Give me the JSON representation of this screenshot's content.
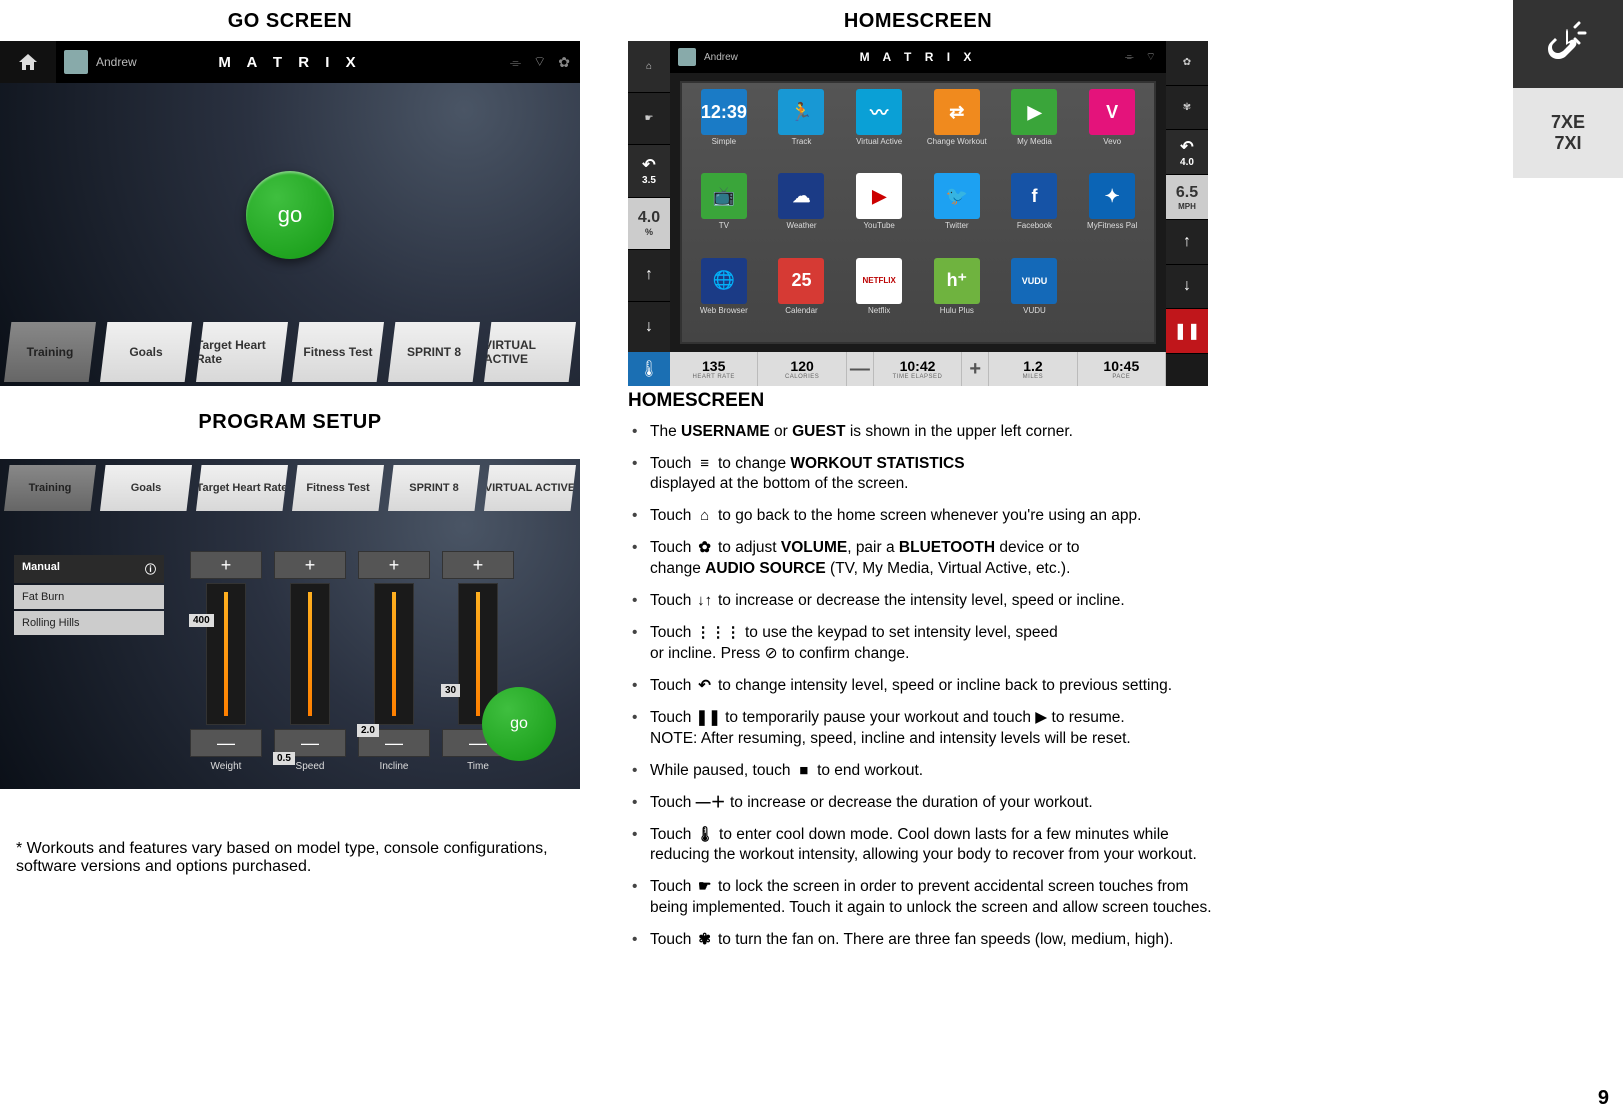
{
  "titles": {
    "go": "GO SCREEN",
    "program": "PROGRAM SETUP",
    "home": "HOMESCREEN"
  },
  "go_screen": {
    "user": "Andrew",
    "logo": "M A T R I X",
    "go_label": "go",
    "tabs": [
      "Training",
      "Goals",
      "Target Heart Rate",
      "Fitness Test",
      "SPRINT 8",
      "VIRTUAL ACTIVE"
    ]
  },
  "program_setup": {
    "tabs": [
      "Training",
      "Goals",
      "Target Heart Rate",
      "Fitness Test",
      "SPRINT 8",
      "VIRTUAL ACTIVE"
    ],
    "menu": [
      "Manual",
      "Fat Burn",
      "Rolling Hills"
    ],
    "sliders": [
      {
        "label": "Weight",
        "value": "400"
      },
      {
        "label": "Speed",
        "value": "0.5"
      },
      {
        "label": "Incline",
        "value": "2.0"
      },
      {
        "label": "Time",
        "value": "30"
      }
    ],
    "go_label": "go"
  },
  "home_screen": {
    "user": "Andrew",
    "logo": "M A T R I X",
    "left_rail": {
      "back_val": "3.5",
      "pct_val": "4.0",
      "pct_unit": "%"
    },
    "right_rail": {
      "back_val": "4.0",
      "spd_val": "6.5",
      "spd_unit": "MPH"
    },
    "apps": [
      {
        "label": "Simple",
        "color": "#1a7bc6",
        "glyph": "12:39"
      },
      {
        "label": "Track",
        "color": "#1898d4",
        "glyph": "🏃"
      },
      {
        "label": "Virtual Active",
        "color": "#0aa0d6",
        "glyph": "〰"
      },
      {
        "label": "Change Workout",
        "color": "#f08a1e",
        "glyph": "⇄"
      },
      {
        "label": "My Media",
        "color": "#3aa53a",
        "glyph": "▶"
      },
      {
        "label": "Vevo",
        "color": "#e4137b",
        "glyph": "V"
      },
      {
        "label": "TV",
        "color": "#3aa53a",
        "glyph": "📺"
      },
      {
        "label": "Weather",
        "color": "#1b3b86",
        "glyph": "☁"
      },
      {
        "label": "YouTube",
        "color": "#ffffff",
        "glyph": "▶",
        "fg": "#cc0000"
      },
      {
        "label": "Twitter",
        "color": "#1da1f2",
        "glyph": "🐦"
      },
      {
        "label": "Facebook",
        "color": "#1653a6",
        "glyph": "f"
      },
      {
        "label": "MyFitness Pal",
        "color": "#0b64b5",
        "glyph": "✦"
      },
      {
        "label": "Web Browser",
        "color": "#1b3b86",
        "glyph": "🌐"
      },
      {
        "label": "Calendar",
        "color": "#d63a34",
        "glyph": "25"
      },
      {
        "label": "Netflix",
        "color": "#ffffff",
        "glyph": "NETFLIX",
        "fg": "#b00",
        "fs": "8px"
      },
      {
        "label": "Hulu Plus",
        "color": "#6fb33f",
        "glyph": "h⁺"
      },
      {
        "label": "VUDU",
        "color": "#1469b8",
        "glyph": "VUDU",
        "fs": "9px"
      }
    ],
    "stats": [
      {
        "n": "135",
        "l": "HEART RATE"
      },
      {
        "n": "120",
        "l": "CALORIES"
      },
      {
        "op": "—"
      },
      {
        "n": "10:42",
        "l": "TIME ELAPSED"
      },
      {
        "op": "+"
      },
      {
        "n": "1.2",
        "l": "MILES"
      },
      {
        "n": "10:45",
        "l": "PACE"
      }
    ]
  },
  "instructions": {
    "heading": "HOMESCREEN",
    "items": [
      {
        "html": "The <b>USERNAME</b> or <b>GUEST</b> is shown in the upper left corner."
      },
      {
        "icon": "≡",
        "html": "Touch {ic} to change <b>WORKOUT STATISTICS</b><br>displayed at the bottom of the screen."
      },
      {
        "icon": "⌂",
        "html": "Touch {ic} to go back to the home screen whenever you're using an app."
      },
      {
        "icon": "✿",
        "html": "Touch {ic} to adjust <b>VOLUME</b>, pair a <b>BLUETOOTH</b> device or to<br>change <b>AUDIO SOURCE</b> (TV, My Media, Virtual Active, etc.)."
      },
      {
        "icon": "↓↑",
        "html": "Touch {ic} to increase or decrease the intensity level, speed or incline."
      },
      {
        "icon": "⋮⋮⋮",
        "html": "Touch {ic} to use the keypad to set intensity level, speed<br>or incline. Press ⊘ to confirm change."
      },
      {
        "icon": "↶",
        "html": "Touch {ic} to change intensity level, speed or incline back to previous setting."
      },
      {
        "icon": "❚❚",
        "html": "Touch {ic} to temporarily pause your workout and touch ▶ to resume.<br>NOTE: After resuming, speed, incline and intensity levels will be reset."
      },
      {
        "icon": "■",
        "html": "While paused, touch {ic} to end workout."
      },
      {
        "icon": "—＋",
        "html": "Touch {ic} to increase or decrease the duration of your workout."
      },
      {
        "icon": "🌡",
        "html": "Touch {ic} to enter cool down mode. Cool down lasts for a few minutes while reducing the workout intensity, allowing your body to recover from your workout."
      },
      {
        "icon": "☛",
        "html": "Touch {ic} to lock the screen in order to prevent accidental screen touches from being implemented. Touch it again to unlock the screen and allow screen touches."
      },
      {
        "icon": "✾",
        "html": "Touch {ic} to turn the fan on. There are three fan speeds (low, medium, high)."
      }
    ]
  },
  "footnote": "*  Workouts and features vary based on model type, console configurations, software versions and options purchased.",
  "side": {
    "model1": "7XE",
    "model2": "7XI"
  },
  "page_number": "9"
}
